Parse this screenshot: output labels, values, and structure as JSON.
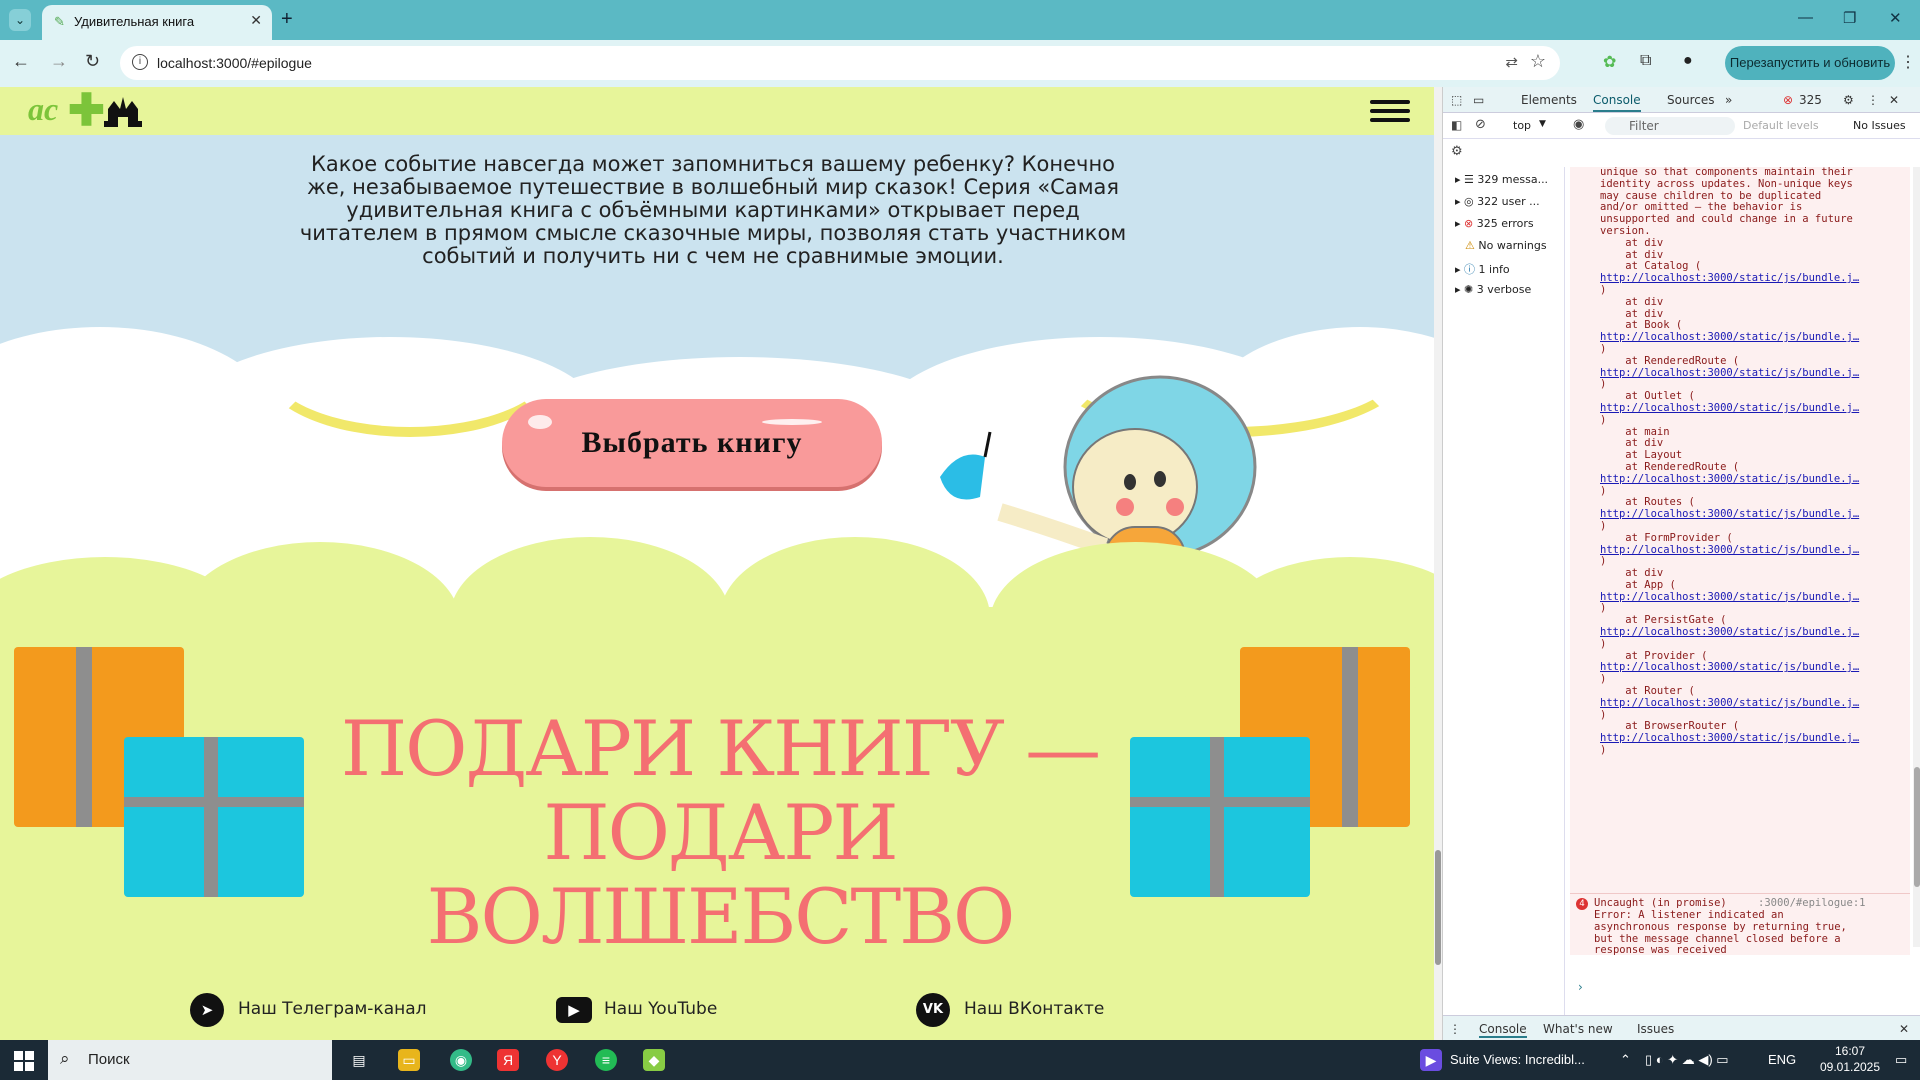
{
  "browser": {
    "tab_title": "Удивительная книга",
    "url": "localhost:3000/#epilogue",
    "relaunch_label": "Перезапустить и обновить"
  },
  "page": {
    "intro_text": "Какое событие навсегда может запомниться вашему ребенку? Конечно же, незабываемое путешествие в волшебный мир сказок! Серия «Самая удивительная книга с объёмными картинками» открывает перед читателем в прямом смысле сказочные миры, позволяя стать участником событий и получить ни с чем не сравнимые эмоции.",
    "choose_button": "Выбрать книгу",
    "gift_title_line1": "ПОДАРИ КНИГУ —",
    "gift_title_line2": "ПОДАРИ ВОЛШЕБСТВО",
    "logo_text": "ac",
    "social": [
      {
        "label": "Наш Телеграм-канал",
        "icon": "telegram-icon"
      },
      {
        "label": "Наш YouTube",
        "icon": "youtube-icon"
      },
      {
        "label": "Наш ВКонтакте",
        "icon": "vk-icon"
      }
    ]
  },
  "devtools": {
    "tabs": [
      "Elements",
      "Console",
      "Sources"
    ],
    "error_count": "325",
    "context": "top",
    "filter_placeholder": "Filter",
    "levels": "Default levels",
    "issues": "No Issues",
    "sidebar": [
      "329 messa...",
      "322 user ...",
      "325 errors",
      "No warnings",
      "1 info",
      "3 verbose"
    ],
    "log_lines": [
      "unique so that components maintain their",
      "identity across updates. Non-unique keys",
      "may cause children to be duplicated",
      "and/or omitted — the behavior is",
      "unsupported and could change in a future",
      "version.",
      "    at div",
      "    at div",
      "    at Catalog (",
      "@http://localhost:3000/static/js/bundle.j…",
      ")",
      "    at div",
      "    at div",
      "    at Book (",
      "@http://localhost:3000/static/js/bundle.j…",
      ")",
      "    at RenderedRoute (",
      "@http://localhost:3000/static/js/bundle.j…",
      ")",
      "    at Outlet (",
      "@http://localhost:3000/static/js/bundle.j…",
      ")",
      "    at main",
      "    at div",
      "    at Layout",
      "    at RenderedRoute (",
      "@http://localhost:3000/static/js/bundle.j…",
      ")",
      "    at Routes (",
      "@http://localhost:3000/static/js/bundle.j…",
      ")",
      "    at FormProvider (",
      "@http://localhost:3000/static/js/bundle.j…",
      ")",
      "    at div",
      "    at App (",
      "@http://localhost:3000/static/js/bundle.j…",
      ")",
      "    at PersistGate (",
      "@http://localhost:3000/static/js/bundle.j…",
      ")",
      "    at Provider (",
      "@http://localhost:3000/static/js/bundle.j…",
      ")",
      "    at Router (",
      "@http://localhost:3000/static/js/bundle.j…",
      ")",
      "    at BrowserRouter (",
      "@http://localhost:3000/static/js/bundle.j…",
      ")"
    ],
    "error2": {
      "count": "4",
      "title": "Uncaught (in promise)",
      "source": ":3000/#epilogue:1",
      "body": "Error: A listener indicated an\nasynchronous response by returning true,\nbut the message channel closed before a\nresponse was received"
    },
    "bottom_tabs": [
      "Console",
      "What's new",
      "Issues"
    ]
  },
  "taskbar": {
    "search_label": "Поиск",
    "now_playing": "Suite Views: Incredibl...",
    "lang": "ENG",
    "time": "16:07",
    "date": "09.01.2025"
  }
}
